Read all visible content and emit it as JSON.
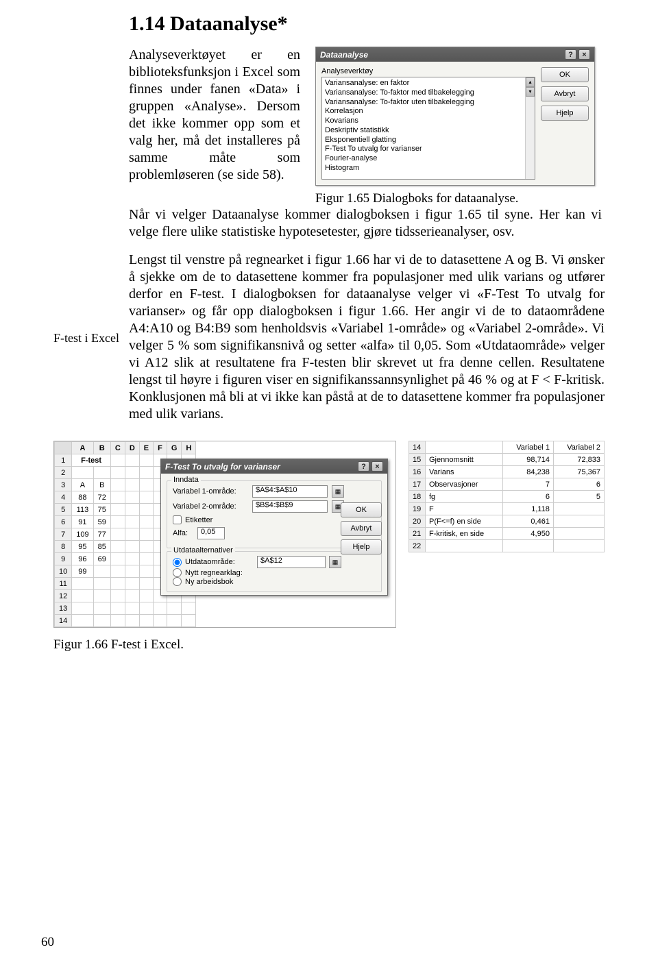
{
  "heading": "1.14  Dataanalyse*",
  "intro": "Analyseverktøyet er en biblioteksfunksjon i Excel som finnes under fanen «Data» i gruppen «Analyse». Dersom det ikke kommer opp som et valg her, må det installeres på samme måte som problemløseren (se side 58).",
  "intro_cont": "Når vi velger Dataanalyse kommer dialogboksen i figur 1.65 til syne. Her kan vi velge flere ulike statistiske hypotesetester, gjøre tidsserieanalyser, osv.",
  "caption1": "Figur 1.65  Dialogboks for dataanalyse.",
  "margin_label": "F-test i Excel",
  "body": "Lengst til venstre på regnearket i figur 1.66 har vi de to datasettene A og B. Vi ønsker å sjekke om de to datasettene kommer fra populasjoner med ulik varians og utfører derfor en F-test. I dialogboksen for dataanalyse velger vi «F-Test To utvalg for varianser» og får opp dialogboksen i figur 1.66. Her angir vi de to dataområdene A4:A10 og B4:B9 som henholdsvis «Variabel 1-område» og «Variabel 2-område». Vi velger 5 % som signifikansnivå og setter «alfa» til 0,05. Som «Utdataområde» velger vi A12 slik at resultatene fra F-testen blir skrevet ut fra denne cellen. Resultatene lengst til høyre i figuren viser en signifikanssannsynlighet på 46 % og at F < F-kritisk. Konklusjonen må bli at vi ikke kan påstå at de to datasettene kommer fra populasjoner med ulik varians.",
  "caption2": "Figur 1.66  F-test i Excel.",
  "page": "60",
  "dialog1": {
    "title": "Dataanalyse",
    "label": "Analyseverktøy",
    "items": [
      "Variansanalyse: en faktor",
      "Variansanalyse: To-faktor med tilbakelegging",
      "Variansanalyse: To-faktor uten tilbakelegging",
      "Korrelasjon",
      "Kovarians",
      "Deskriptiv statistikk",
      "Eksponentiell glatting",
      "F-Test To utvalg for varianser",
      "Fourier-analyse",
      "Histogram"
    ],
    "ok": "OK",
    "cancel": "Avbryt",
    "help": "Hjelp"
  },
  "sheet": {
    "cols": [
      "A",
      "B",
      "C",
      "D",
      "E",
      "F",
      "G",
      "H"
    ],
    "rows": [
      "1",
      "2",
      "3",
      "4",
      "5",
      "6",
      "7",
      "8",
      "9",
      "10",
      "11",
      "12",
      "13",
      "14"
    ],
    "title": "F-test",
    "h3a": "A",
    "h3b": "B",
    "data": [
      [
        "88",
        "72"
      ],
      [
        "113",
        "75"
      ],
      [
        "91",
        "59"
      ],
      [
        "109",
        "77"
      ],
      [
        "95",
        "85"
      ],
      [
        "96",
        "69"
      ],
      [
        "99",
        ""
      ]
    ]
  },
  "ftest": {
    "title": "F-Test To utvalg for varianser",
    "inndata": "Inndata",
    "v1label": "Variabel 1-område:",
    "v1val": "$A$4:$A$10",
    "v2label": "Variabel 2-område:",
    "v2val": "$B$4:$B$9",
    "etiketter": "Etiketter",
    "alfalabel": "Alfa:",
    "alfa": "0,05",
    "utdata": "Utdataalternativer",
    "utlabel": "Utdataområde:",
    "utval": "$A$12",
    "nytt": "Nytt regnearklag:",
    "nyarb": "Ny arbeidsbok",
    "ok": "OK",
    "cancel": "Avbryt",
    "help": "Hjelp"
  },
  "results": {
    "rownums": [
      "14",
      "15",
      "16",
      "17",
      "18",
      "19",
      "20",
      "21",
      "22"
    ],
    "h1": "Variabel 1",
    "h2": "Variabel 2",
    "rows": [
      {
        "label": "Gjennomsnitt",
        "v1": "98,714",
        "v2": "72,833"
      },
      {
        "label": "Varians",
        "v1": "84,238",
        "v2": "75,367"
      },
      {
        "label": "Observasjoner",
        "v1": "7",
        "v2": "6"
      },
      {
        "label": "fg",
        "v1": "6",
        "v2": "5"
      },
      {
        "label": "F",
        "v1": "1,118",
        "v2": ""
      },
      {
        "label": "P(F<=f) en side",
        "v1": "0,461",
        "v2": ""
      },
      {
        "label": "F-kritisk, en side",
        "v1": "4,950",
        "v2": ""
      }
    ]
  }
}
